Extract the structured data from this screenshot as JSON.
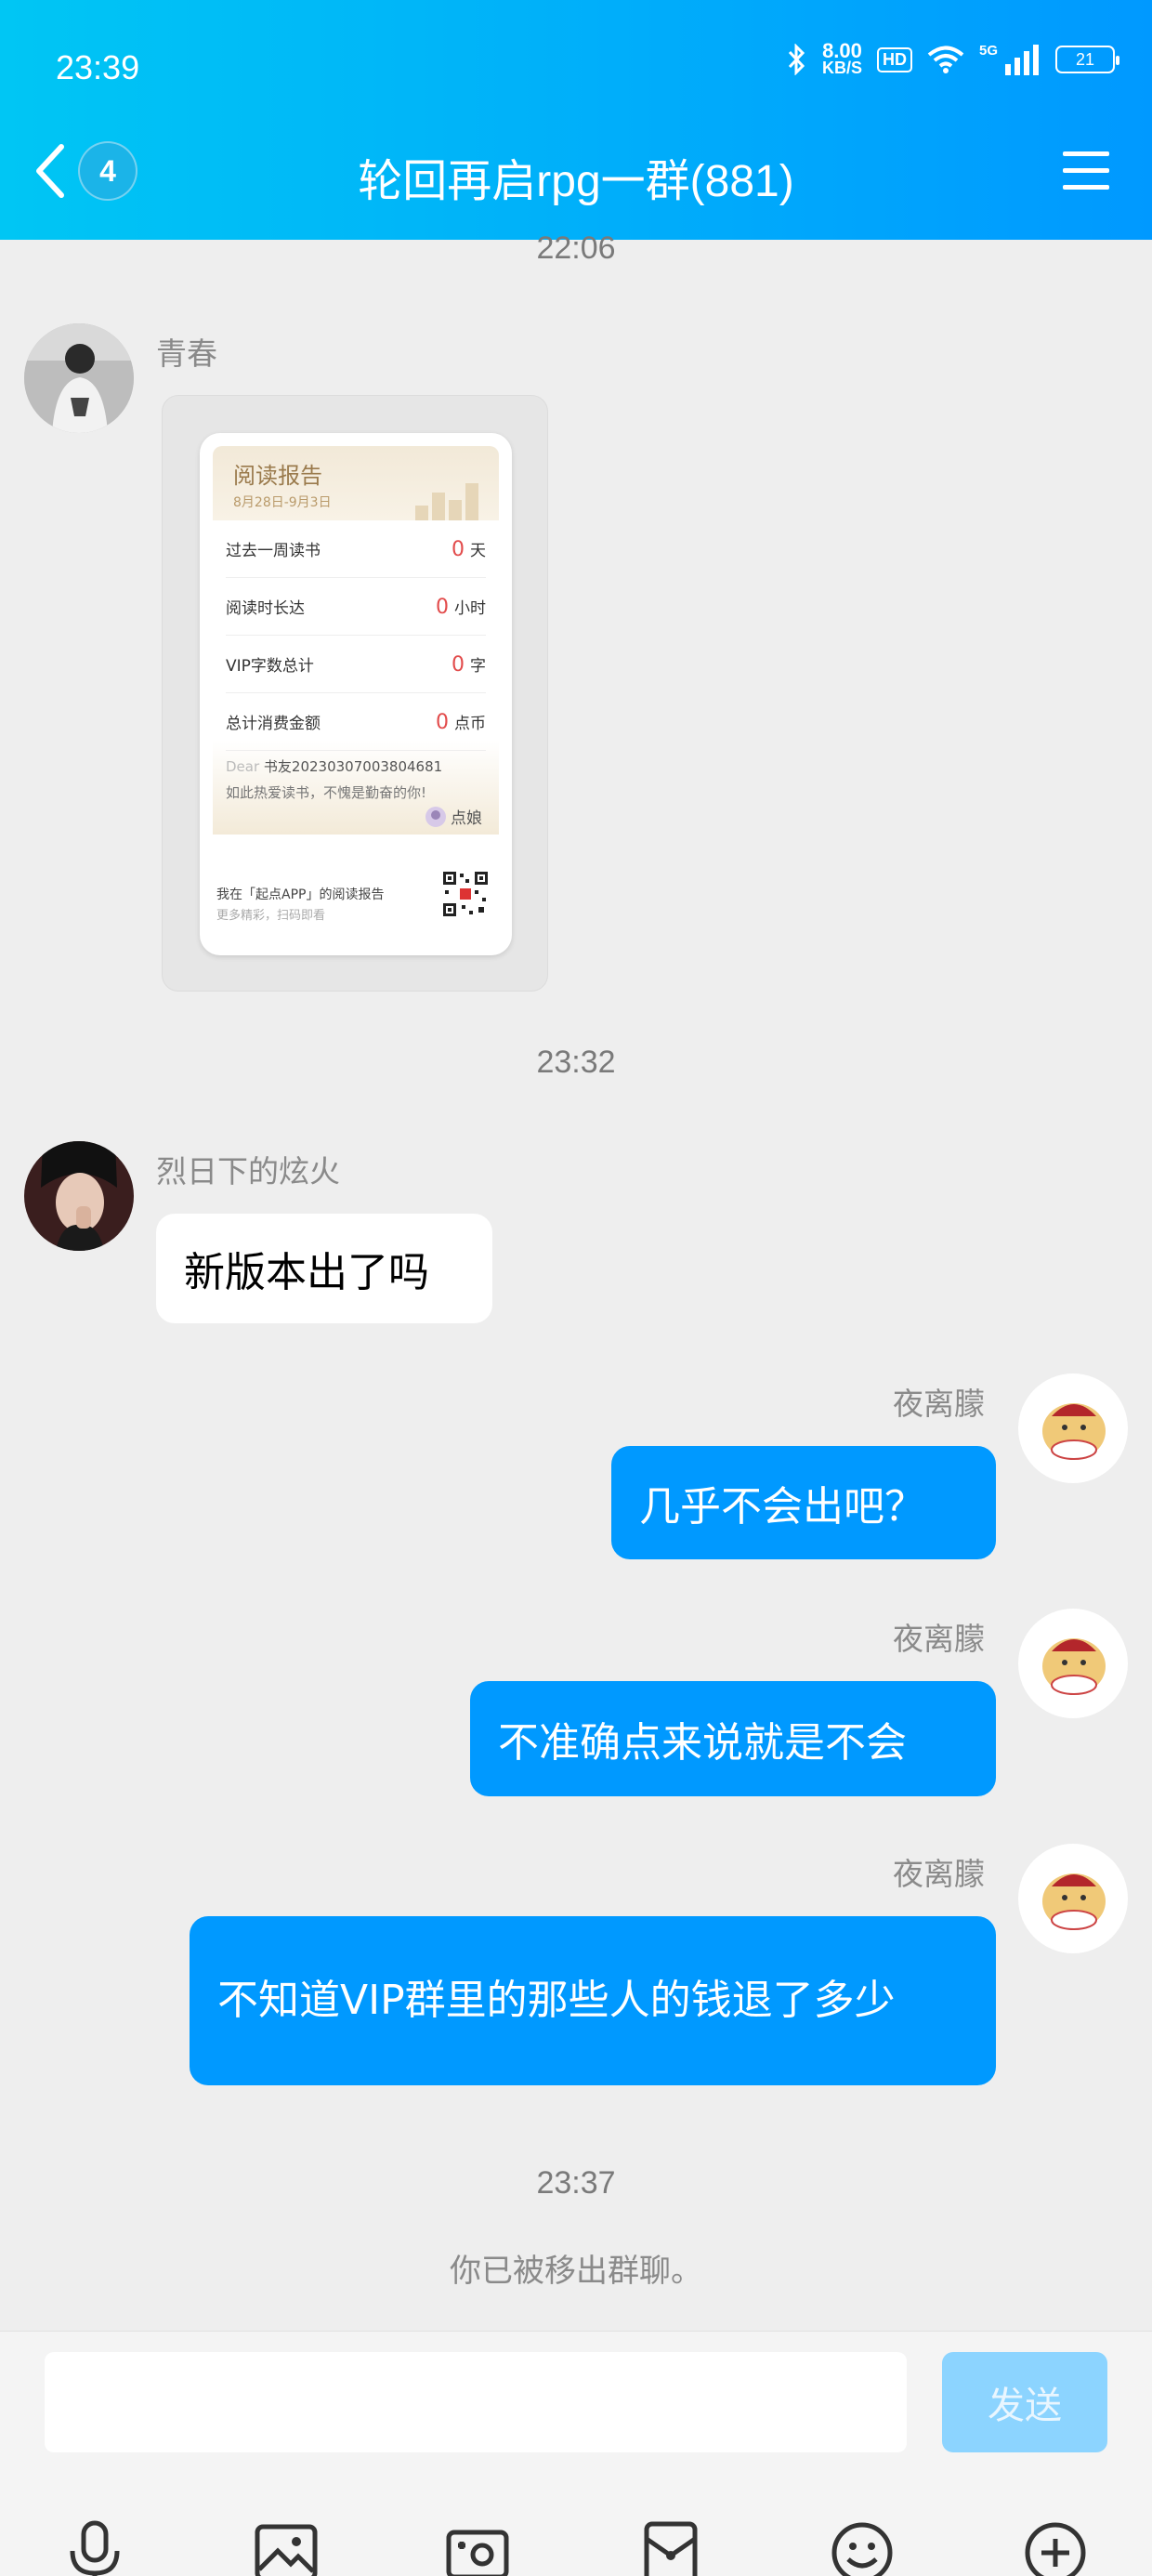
{
  "status_bar": {
    "time": "23:39",
    "net_speed_value": "8.00",
    "net_speed_unit": "KB/S",
    "hd_label": "HD",
    "network_label": "5G",
    "battery": "21"
  },
  "header": {
    "unread_count": "4",
    "title": "轮回再启rpg一群(881)"
  },
  "messages": {
    "ts_top": "22:06",
    "m1": {
      "sender": "青春",
      "card": {
        "title": "阅读报告",
        "date_range": "8月28日-9月3日",
        "rows": [
          {
            "label": "过去一周读书",
            "value": "0",
            "unit": "天"
          },
          {
            "label": "阅读时长达",
            "value": "0",
            "unit": "小时"
          },
          {
            "label": "VIP字数总计",
            "value": "0",
            "unit": "字"
          },
          {
            "label": "总计消费金额",
            "value": "0",
            "unit": "点币"
          }
        ],
        "dear_prefix": "Dear",
        "dear_text": "书友20230307003804681",
        "encourage": "如此热爱读书，不愧是勤奋的你!",
        "signature": "点娘",
        "footer1": "我在「起点APP」的阅读报告",
        "footer2": "更多精彩，扫码即看"
      }
    },
    "ts_mid": "23:32",
    "m2": {
      "sender": "烈日下的炫火",
      "text": "新版本出了吗"
    },
    "m3": {
      "sender": "夜离朦",
      "text": "几乎不会出吧？"
    },
    "m4": {
      "sender": "夜离朦",
      "text": "不准确点来说就是不会"
    },
    "m5": {
      "sender": "夜离朦",
      "text": "不知道VIP群里的那些人的钱退了多少"
    },
    "ts_end": "23:37",
    "system": "你已被移出群聊。"
  },
  "input": {
    "value": "",
    "send_label": "发送"
  },
  "colors": {
    "header_start": "#00c6f4",
    "header_end": "#0099ff",
    "bubble_self": "#0099ff",
    "send_disabled": "#8cd4ff",
    "stat_number": "#e24b4b"
  },
  "toolbar_icons": [
    "microphone-icon",
    "image-icon",
    "camera-icon",
    "red-packet-icon",
    "emoji-icon",
    "plus-icon"
  ]
}
